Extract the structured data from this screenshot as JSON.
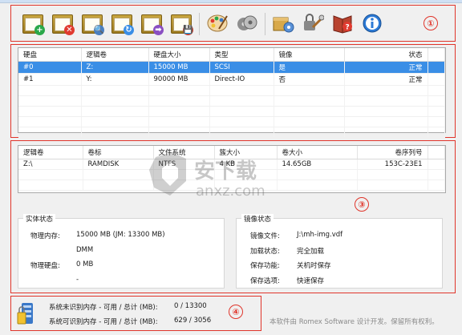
{
  "markers": [
    "①",
    "②",
    "③",
    "④"
  ],
  "toolbar": {
    "buttons": [
      {
        "name": "add-disk-icon",
        "badge": "+",
        "badge_color": "#2aa84a"
      },
      {
        "name": "remove-disk-icon",
        "badge": "✕",
        "badge_color": "#e03a2f"
      },
      {
        "name": "view-disk-icon",
        "badge": "🔍",
        "badge_color": "#4a7fc0"
      },
      {
        "name": "refresh-disk-icon",
        "badge": "↻",
        "badge_color": "#3a8ee6"
      },
      {
        "name": "load-disk-icon",
        "badge": "➡",
        "badge_color": "#8a4fc2"
      },
      {
        "name": "save-disk-icon",
        "badge": "💾",
        "badge_color": "#c0392b"
      },
      {
        "name": "palette-icon",
        "badge": "",
        "badge_color": ""
      },
      {
        "name": "disks-settings-icon",
        "badge": "",
        "badge_color": ""
      },
      {
        "name": "package-settings-icon",
        "badge": "",
        "badge_color": ""
      },
      {
        "name": "tools-settings-icon",
        "badge": "",
        "badge_color": ""
      },
      {
        "name": "help-book-icon",
        "badge": "?",
        "badge_color": "#e03a2f"
      },
      {
        "name": "info-icon",
        "badge": "i",
        "badge_color": "#1e6ec8"
      }
    ]
  },
  "disk_table": {
    "headers": [
      "硬盘",
      "逻辑卷",
      "硬盘大小",
      "类型",
      "镜像",
      "状态"
    ],
    "rows": [
      [
        "#0",
        "Z:",
        "15000 MB",
        "SCSI",
        "是",
        "正常"
      ],
      [
        "#1",
        "Y:",
        "90000 MB",
        "Direct-IO",
        "否",
        "正常"
      ]
    ]
  },
  "volume_table": {
    "headers": [
      "逻辑卷",
      "卷标",
      "文件系统",
      "簇大小",
      "卷大小",
      "卷序列号"
    ],
    "rows": [
      [
        "Z:\\",
        "RAMDISK",
        "NTFS",
        "4 KB",
        "14.65GB",
        "153C-23E1"
      ]
    ]
  },
  "entity_status": {
    "title": "实体状态",
    "items": [
      {
        "label": "物理内存:",
        "value": "15000 MB (JM: 13300 MB)"
      },
      {
        "label": "",
        "value": "DMM"
      },
      {
        "label": "物理硬盘:",
        "value": "0 MB"
      },
      {
        "label": "",
        "value": "-"
      }
    ]
  },
  "image_status": {
    "title": "镜像状态",
    "items": [
      {
        "label": "镜像文件:",
        "value": "J:\\mh-img.vdf"
      },
      {
        "label": "加载状态:",
        "value": "完全加载"
      },
      {
        "label": "保存功能:",
        "value": "关机时保存"
      },
      {
        "label": "保存选项:",
        "value": "快速保存"
      }
    ]
  },
  "footer": {
    "unrecognized_label": "系统未识别内存 - 可用 / 总计 (MB):",
    "unrecognized_value": "0 / 13300",
    "recognized_label": "系统可识别内存 - 可用 / 总计 (MB):",
    "recognized_value": "629 / 3056",
    "copyright": "本软件由 Romex Software 设计开发。保留所有权利。"
  },
  "watermark": {
    "text_cn": "安下载",
    "text_en": "anxz.com"
  },
  "colors": {
    "accent_red": "#e0352b",
    "selection": "#3a8ee6"
  }
}
